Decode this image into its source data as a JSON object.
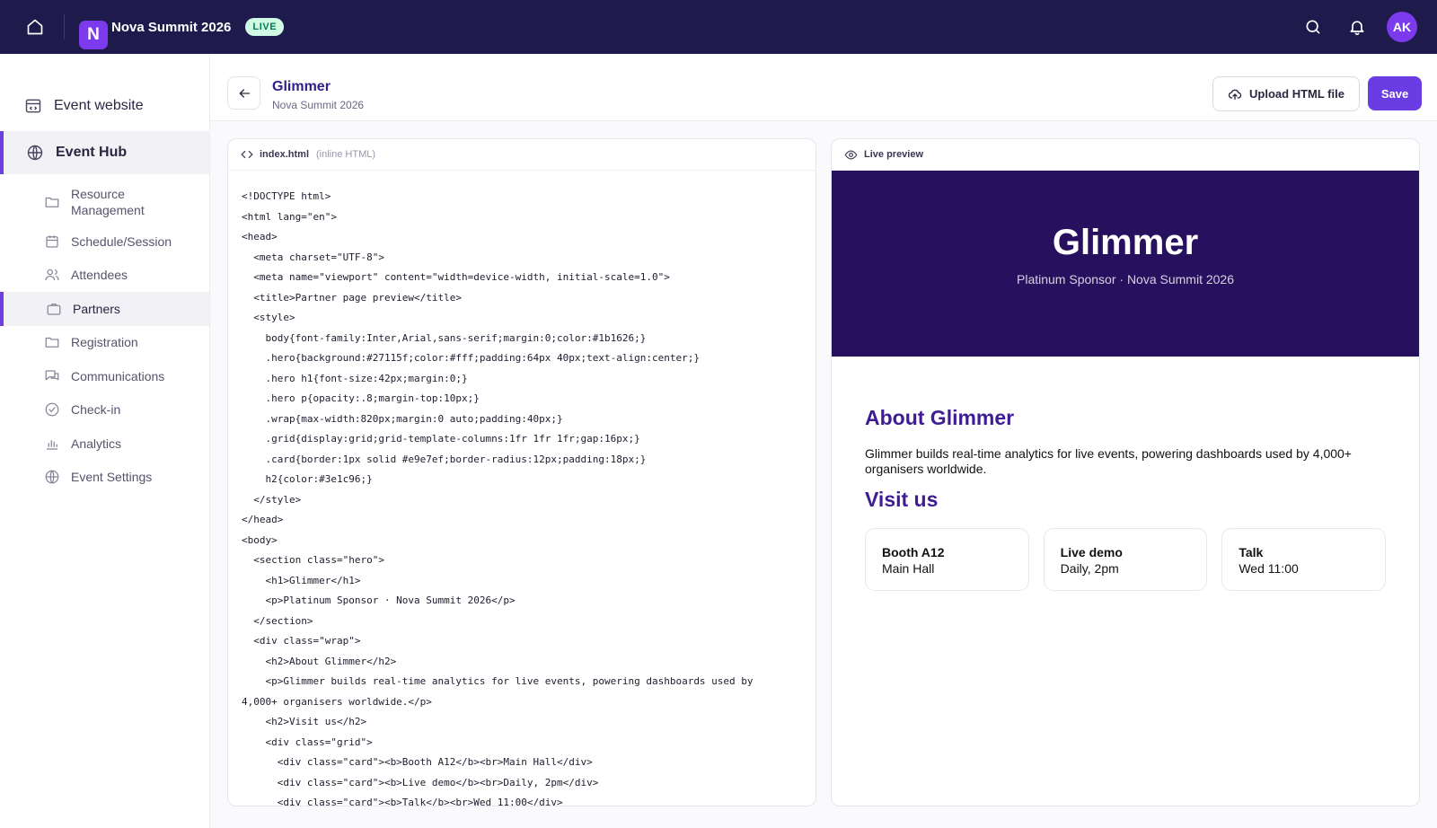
{
  "topbar": {
    "logo_letter": "N",
    "event_title": "Nova Summit 2026",
    "live_badge": "LIVE",
    "avatar_initials": "AK"
  },
  "sidebar": {
    "top_items": [
      {
        "label": "Event website",
        "icon": "website-icon"
      },
      {
        "label": "Event Hub",
        "icon": "globe-icon",
        "active": true
      }
    ],
    "sub_items": [
      {
        "label": "Resource Management",
        "icon": "folder-icon"
      },
      {
        "label": "Schedule/Session",
        "icon": "calendar-icon"
      },
      {
        "label": "Attendees",
        "icon": "users-icon"
      },
      {
        "label": "Partners",
        "icon": "briefcase-icon",
        "active": true
      },
      {
        "label": "Registration",
        "icon": "folder-icon"
      },
      {
        "label": "Communications",
        "icon": "chat-icon"
      },
      {
        "label": "Check-in",
        "icon": "check-circle-icon"
      },
      {
        "label": "Analytics",
        "icon": "bar-chart-icon"
      },
      {
        "label": "Event Settings",
        "icon": "globe-icon"
      }
    ]
  },
  "header": {
    "title": "Glimmer",
    "subtitle": "Nova Summit 2026",
    "upload_label": "Upload HTML file",
    "save_label": "Save"
  },
  "editor": {
    "filename": "index.html",
    "mode": "(inline HTML)",
    "lines": [
      "<!DOCTYPE html>",
      "<html lang=\"en\">",
      "<head>",
      "  <meta charset=\"UTF-8\">",
      "  <meta name=\"viewport\" content=\"width=device-width, initial-scale=1.0\">",
      "  <title>Partner page preview</title>",
      "  <style>",
      "    body{font-family:Inter,Arial,sans-serif;margin:0;color:#1b1626;}",
      "    .hero{background:#27115f;color:#fff;padding:64px 40px;text-align:center;}",
      "    .hero h1{font-size:42px;margin:0;}",
      "    .hero p{opacity:.8;margin-top:10px;}",
      "    .wrap{max-width:820px;margin:0 auto;padding:40px;}",
      "    .grid{display:grid;grid-template-columns:1fr 1fr 1fr;gap:16px;}",
      "    .card{border:1px solid #e9e7ef;border-radius:12px;padding:18px;}",
      "    h2{color:#3e1c96;}",
      "  </style>",
      "</head>",
      "<body>",
      "  <section class=\"hero\">",
      "    <h1>Glimmer</h1>",
      "    <p>Platinum Sponsor · Nova Summit 2026</p>",
      "  </section>",
      "  <div class=\"wrap\">",
      "    <h2>About Glimmer</h2>",
      "    <p>Glimmer builds real-time analytics for live events, powering dashboards used by",
      "4,000+ organisers worldwide.</p>",
      "    <h2>Visit us</h2>",
      "    <div class=\"grid\">",
      "      <div class=\"card\"><b>Booth A12</b><br>Main Hall</div>",
      "      <div class=\"card\"><b>Live demo</b><br>Daily, 2pm</div>",
      "      <div class=\"card\"><b>Talk</b><br>Wed 11:00</div>"
    ]
  },
  "preview": {
    "label": "Live preview",
    "hero_title": "Glimmer",
    "hero_subtitle": "Platinum Sponsor · Nova Summit 2026",
    "about_heading": "About Glimmer",
    "about_text": "Glimmer builds real-time analytics for live events, powering dashboards used by 4,000+ organisers worldwide.",
    "visit_heading": "Visit us",
    "cards": [
      {
        "title": "Booth A12",
        "detail": "Main Hall"
      },
      {
        "title": "Live demo",
        "detail": "Daily, 2pm"
      },
      {
        "title": "Talk",
        "detail": "Wed 11:00"
      }
    ]
  },
  "colors": {
    "topbar_bg": "#1e1a4b",
    "accent": "#6a3de4",
    "hero_bg": "#27115f",
    "heading": "#3e1c96"
  }
}
